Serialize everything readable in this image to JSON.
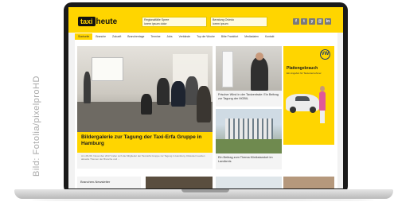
{
  "credit": "Bild: Fotolia/pixelproHD",
  "site": {
    "logo": {
      "part1": "taxi",
      "part2": "heute"
    },
    "header_boxes": [
      "Regionalfälle Spree",
      "Beratung Oviedo"
    ],
    "header_box_sub": [
      "lorem ipsum dolor",
      "lorem ipsum"
    ],
    "social_icons": [
      "f",
      "t",
      "y",
      "@",
      "in"
    ],
    "nav": [
      "Startseite",
      "Branche",
      "Zukunft",
      "Branchentage",
      "Termine",
      "Jobs",
      "Verbände",
      "Top der Woche",
      "Bitte Frankfurt",
      "Mediadaten",
      "Kontakt"
    ],
    "active_nav_index": 0
  },
  "hero": {
    "title": "Bildergalerie zur Tagung der Taxi-Erfa Gruppe in Hamburg",
    "text": "Am 28./29. November 2017 trafen sich die Mitglieder der Taxi-Erfa Gruppe zur Tagung in Hamburg. Diskutiert wurden aktuelle Themen der Branche und ..."
  },
  "cards": [
    {
      "caption": "Frischer Wind in der Taxizentrale: Ein Beitrag zur Tagung der MOBIL"
    },
    {
      "caption": "Ein Beitrag zum Thema Klinikstandort im Landkreis"
    }
  ],
  "ad": {
    "brand": "VW",
    "title": "Plattengebrauch",
    "subtitle": "Ein Angebot für Taxiunternehmer"
  },
  "bottom": {
    "section_label": "Branchen-Newsletter"
  }
}
